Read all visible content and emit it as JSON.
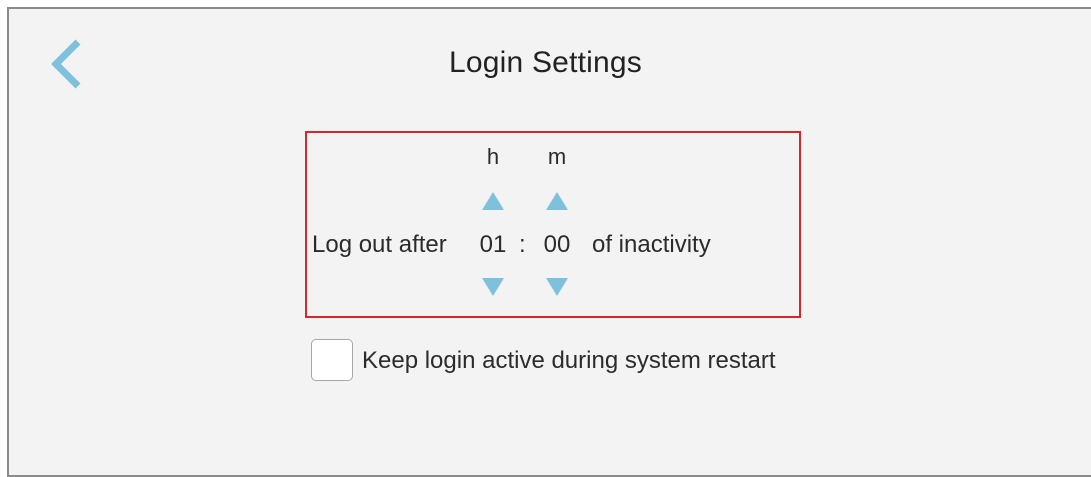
{
  "header": {
    "title": "Login Settings",
    "back_icon": "chevron-left-icon"
  },
  "logout": {
    "hours_label": "h",
    "minutes_label": "m",
    "prefix": "Log out after",
    "hours_value": "01",
    "separator": ":",
    "minutes_value": "00",
    "suffix": "of inactivity",
    "up_icon": "triangle-up-icon",
    "down_icon": "triangle-down-icon"
  },
  "options": {
    "keep_login_label": "Keep login active during system restart",
    "keep_login_checked": false
  },
  "colors": {
    "accent": "#7fc1dd",
    "highlight": "#d8262b",
    "background": "#f3f3f3"
  }
}
